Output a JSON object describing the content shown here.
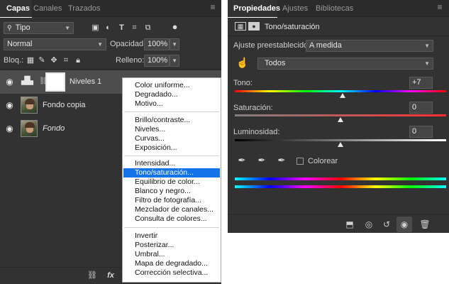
{
  "layers_panel": {
    "tabs": [
      "Capas",
      "Canales",
      "Trazados"
    ],
    "filter_label": "Tipo",
    "blend_mode": "Normal",
    "opacity_label": "Opacidad:",
    "opacity_value": "100%",
    "lock_label": "Bloq.:",
    "fill_label": "Relleno:",
    "fill_value": "100%",
    "layers": [
      {
        "name": "Niveles 1",
        "type": "adjustment",
        "selected": true,
        "italic": false
      },
      {
        "name": "Fondo copia",
        "type": "image",
        "selected": false,
        "italic": false
      },
      {
        "name": "Fondo",
        "type": "image",
        "selected": false,
        "italic": true
      }
    ],
    "footer_icons": [
      "link-icon",
      "fx-icon"
    ],
    "footer_fx_label": "fx"
  },
  "adjustment_menu": {
    "groups": [
      [
        "Color uniforme...",
        "Degradado...",
        "Motivo..."
      ],
      [
        "Brillo/contraste...",
        "Niveles...",
        "Curvas...",
        "Exposición..."
      ],
      [
        "Intensidad...",
        "Tono/saturación...",
        "Equilibrio de color...",
        "Blanco y negro...",
        "Filtro de fotografía...",
        "Mezclador de canales...",
        "Consulta de colores..."
      ],
      [
        "Invertir",
        "Posterizar...",
        "Umbral...",
        "Mapa de degradado...",
        "Corrección selectiva..."
      ]
    ],
    "highlighted": "Tono/saturación..."
  },
  "properties_panel": {
    "tabs": [
      "Propiedades",
      "Ajustes",
      "Bibliotecas"
    ],
    "title": "Tono/saturación",
    "preset_label": "Ajuste preestablecido:",
    "preset_value": "A medida",
    "channel_value": "Todos",
    "hue_label": "Tono:",
    "hue_value": "+7",
    "hue_position": 0.51,
    "saturation_label": "Saturación:",
    "saturation_value": "0",
    "saturation_position": 0.5,
    "lightness_label": "Luminosidad:",
    "lightness_value": "0",
    "lightness_position": 0.5,
    "colorize_label": "Colorear",
    "colorize_checked": false
  },
  "colors": {
    "panel_bg": "#323232",
    "menu_highlight": "#1473e6",
    "text": "#d6d6d6"
  }
}
